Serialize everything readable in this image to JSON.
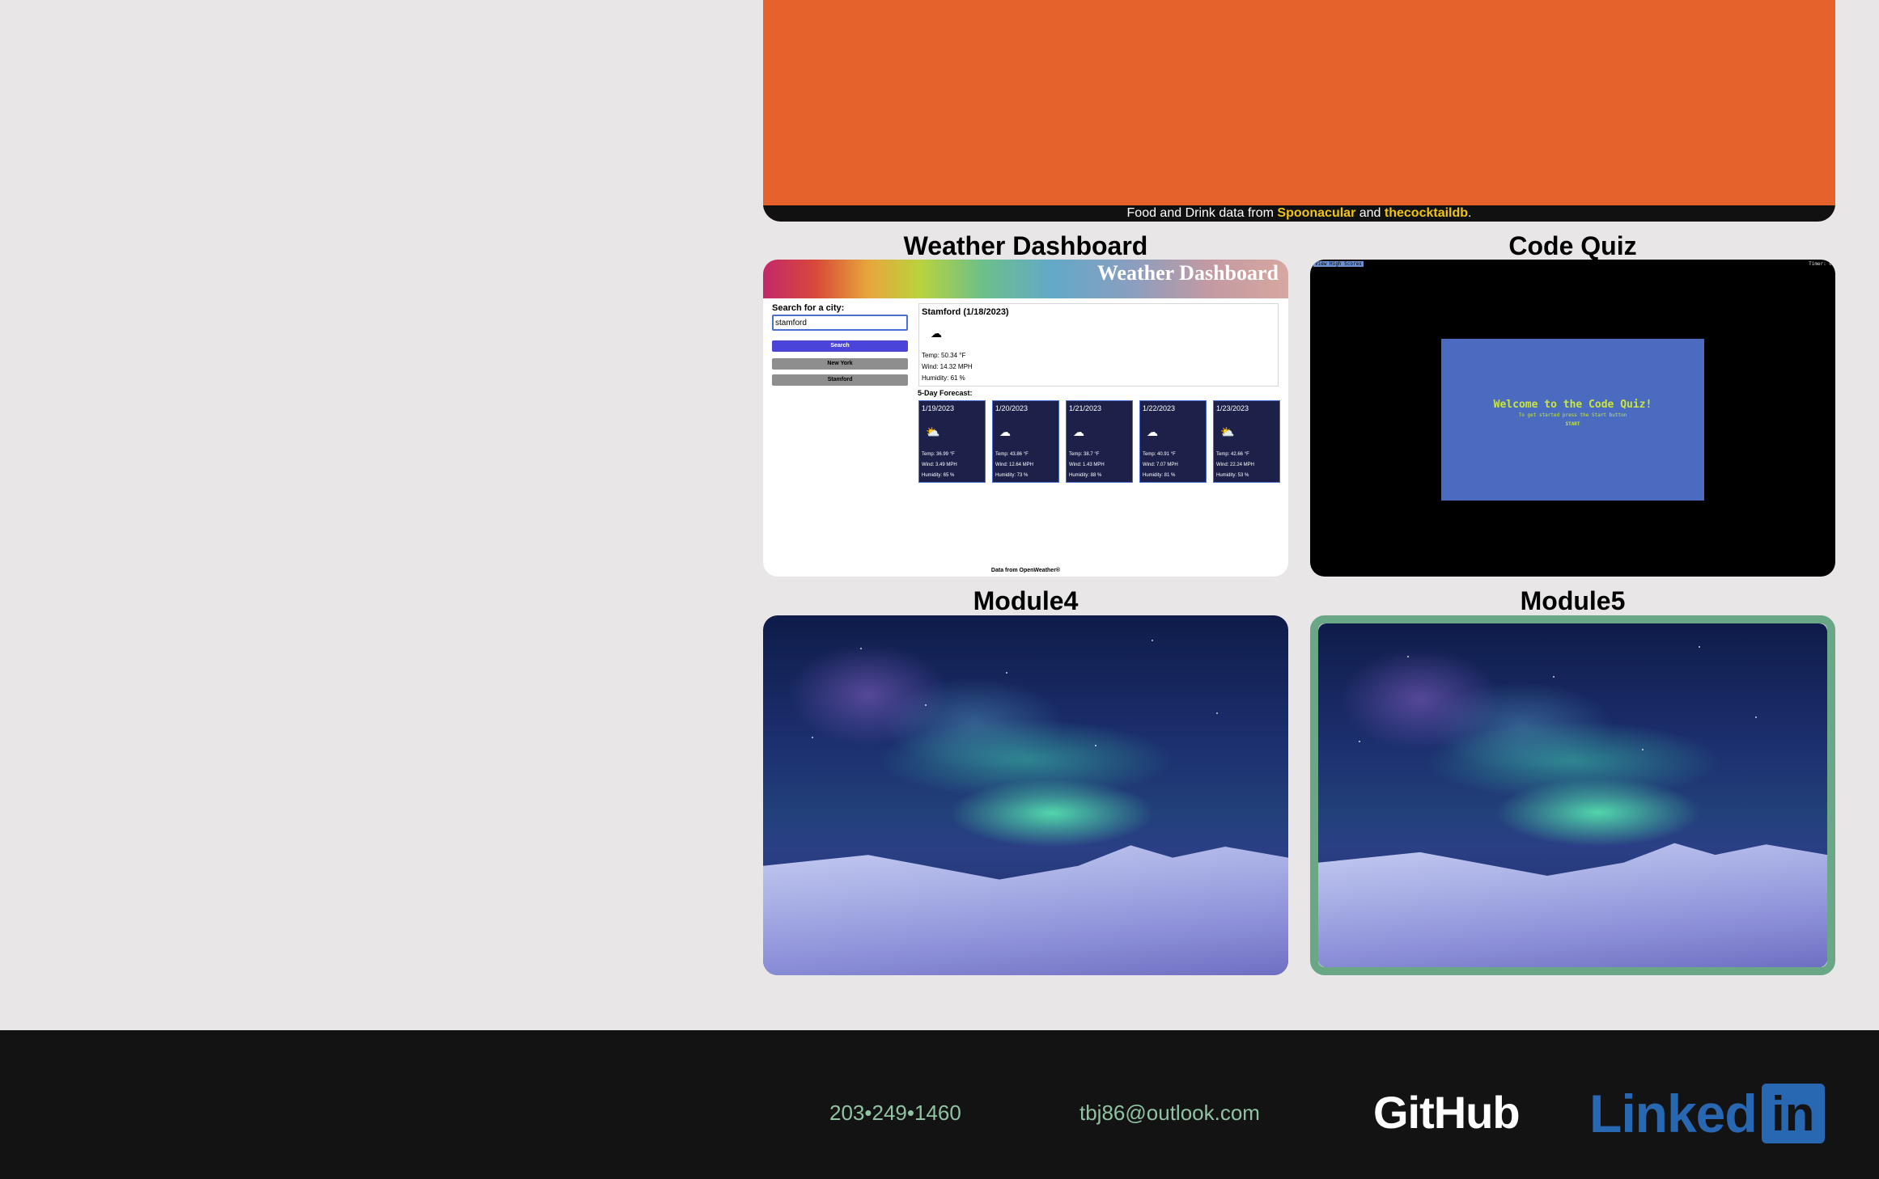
{
  "top_project": {
    "credit_prefix": "Food and Drink data from ",
    "credit_source1": "Spoonacular",
    "credit_and": " and ",
    "credit_source2": "thecocktaildb",
    "credit_suffix": "."
  },
  "projects": [
    {
      "title": "Weather Dashboard",
      "preview": {
        "banner_title": "Weather Dashboard",
        "search_label": "Search for a city:",
        "search_value": "stamford",
        "search_button": "Search",
        "history": [
          "New York",
          "Stamford"
        ],
        "today": {
          "city": "Stamford  (1/18/2023)",
          "icon": "cloud-icon",
          "temp": "Temp: 50.34 °F",
          "wind": "Wind: 14.32 MPH",
          "humidity": "Humidity: 61 %"
        },
        "forecast_label": "5-Day Forecast:",
        "forecast": [
          {
            "date": "1/19/2023",
            "icon": "sun-cloud-icon",
            "temp": "Temp: 36.99 °F",
            "wind": "Wind: 3.49 MPH",
            "humidity": "Humidity: 65 %"
          },
          {
            "date": "1/20/2023",
            "icon": "cloud-icon",
            "temp": "Temp: 43.86 °F",
            "wind": "Wind: 12.64 MPH",
            "humidity": "Humidity: 73 %"
          },
          {
            "date": "1/21/2023",
            "icon": "cloud-icon",
            "temp": "Temp: 38.7 °F",
            "wind": "Wind: 1.43 MPH",
            "humidity": "Humidity: 88 %"
          },
          {
            "date": "1/22/2023",
            "icon": "cloud-icon",
            "temp": "Temp: 40.91 °F",
            "wind": "Wind: 7.07 MPH",
            "humidity": "Humidity: 81 %"
          },
          {
            "date": "1/23/2023",
            "icon": "sun-cloud-icon",
            "temp": "Temp: 42.66 °F",
            "wind": "Wind: 22.24 MPH",
            "humidity": "Humidity: 53 %"
          }
        ],
        "footer": "Data from OpenWeather®"
      }
    },
    {
      "title": "Code Quiz",
      "preview": {
        "high_scores": "View High Scores",
        "timer": "Timer: 0",
        "heading": "Welcome to the Code Quiz!",
        "subtext": "To get started press the Start button",
        "start": "START"
      }
    },
    {
      "title": "Module4",
      "preview": {
        "image": "aurora-landscape"
      }
    },
    {
      "title": "Module5",
      "preview": {
        "image": "aurora-landscape"
      }
    }
  ],
  "footer": {
    "phone": "203•249•1460",
    "email": "tbj86@outlook.com",
    "github": "GitHub",
    "linkedin_word": "Linked",
    "linkedin_in": "in"
  },
  "colors": {
    "page_bg": "#e8e6e7",
    "top_card": "#e6622c",
    "credit_highlight": "#f1c40f",
    "active_border": "#6aa787",
    "footer_bg": "#131313",
    "footer_contact": "#8fc3a2",
    "linkedin_blue": "#2867b2"
  }
}
